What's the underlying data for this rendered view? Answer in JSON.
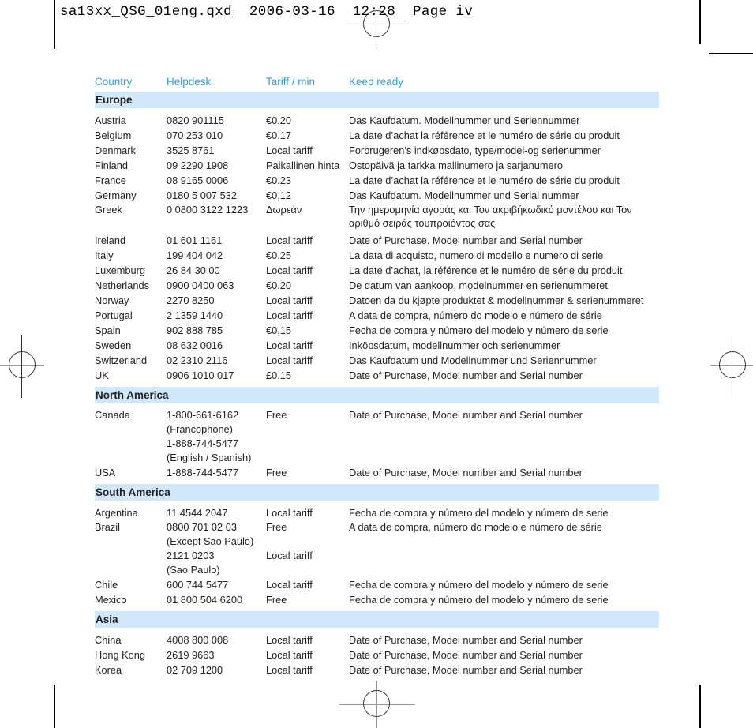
{
  "slug": "sa13xx_QSG_01eng.qxd  2006-03-16  12:28  Page iv",
  "colors": {
    "header_text": "#2e9ee0",
    "section_band": "#d0e8fa",
    "body_text": "#231f20"
  },
  "table": {
    "columns": [
      "Country",
      "Helpdesk",
      "Tariff / min",
      "Keep ready"
    ],
    "sections": [
      {
        "name": "Europe",
        "rows": [
          {
            "country": "Austria",
            "helpdesk": "0820 901115",
            "tariff": "€0.20",
            "keep": "Das Kaufdatum. Modellnummer und Seriennummer"
          },
          {
            "country": "Belgium",
            "helpdesk": "070 253 010",
            "tariff": "€0.17",
            "keep": "La date d’achat la référence et le numéro de série du produit"
          },
          {
            "country": "Denmark",
            "helpdesk": "3525 8761",
            "tariff": "Local tariff",
            "keep": "Forbrugeren's indkøbsdato, type/model-og serienummer"
          },
          {
            "country": "Finland",
            "helpdesk": "09 2290 1908",
            "tariff": "Paikallinen hinta",
            "keep": "Ostopäivä ja tarkka mallinumero ja sarjanumero"
          },
          {
            "country": "France",
            "helpdesk": "08 9165 0006",
            "tariff": "€0.23",
            "keep": "La date d’achat la référence et le numéro de série du produit"
          },
          {
            "country": "Germany",
            "helpdesk": "0180 5 007 532",
            "tariff": "€0,12",
            "keep": "Das Kaufdatum. Modellnummer und Serial nummer"
          },
          {
            "country": "Greek",
            "helpdesk": "0 0800 3122 1223",
            "tariff": "Δωρεάν",
            "keep": "Την ημερομηνία αγοράς και Τον ακριβήκωδικό μοντέλου και Τον\nαριθμό σειράς τουπροϊόντος σας"
          },
          {
            "country": "Ireland",
            "helpdesk": "01 601 1161",
            "tariff": "Local tariff",
            "keep": "Date of Purchase. Model number and Serial number"
          },
          {
            "country": "Italy",
            "helpdesk": "199 404 042",
            "tariff": "€0.25",
            "keep": "La data di acquisto, numero di modello e numero di serie"
          },
          {
            "country": "Luxemburg",
            "helpdesk": "26 84 30 00",
            "tariff": "Local tariff",
            "keep": "La date d’achat, la référence et le numéro de série du produit"
          },
          {
            "country": "Netherlands",
            "helpdesk": "0900 0400 063",
            "tariff": "€0.20",
            "keep": "De datum van aankoop, modelnummer en serienummeret"
          },
          {
            "country": "Norway",
            "helpdesk": "2270 8250",
            "tariff": "Local tariff",
            "keep": "Datoen da du kjøpte produktet & modellnummer & serienummeret"
          },
          {
            "country": "Portugal",
            "helpdesk": "2 1359 1440",
            "tariff": "Local tariff",
            "keep": "A data de compra, número do modelo e número de série"
          },
          {
            "country": "Spain",
            "helpdesk": "902 888 785",
            "tariff": "€0,15",
            "keep": "Fecha de compra y número del modelo y número de serie"
          },
          {
            "country": "Sweden",
            "helpdesk": "08 632 0016",
            "tariff": "Local tariff",
            "keep": "Inköpsdatum, modellnummer och serienummer"
          },
          {
            "country": "Switzerland",
            "helpdesk": "02 2310 2116",
            "tariff": "Local tariff",
            "keep": "Das Kaufdatum und Modellnummer und Seriennummer"
          },
          {
            "country": "UK",
            "helpdesk": "0906 1010 017",
            "tariff": "£0.15",
            "keep": "Date of Purchase, Model number and Serial number"
          }
        ]
      },
      {
        "name": "North America",
        "rows": [
          {
            "country": "Canada",
            "helpdesk": "1-800-661-6162\n(Francophone)\n1-888-744-5477\n(English / Spanish)",
            "tariff": "Free",
            "keep": "Date of Purchase, Model number and Serial number"
          },
          {
            "country": "USA",
            "helpdesk": "1-888-744-5477",
            "tariff": "Free",
            "keep": "Date of Purchase, Model number and Serial number"
          }
        ]
      },
      {
        "name": "South America",
        "rows": [
          {
            "country": "Argentina",
            "helpdesk": "11 4544 2047",
            "tariff": "Local tariff",
            "keep": "Fecha de compra y número del modelo y número de serie"
          },
          {
            "country": "Brazil",
            "helpdesk": "0800 701 02 03\n(Except Sao Paulo)\n2121 0203\n(Sao Paulo)",
            "tariff": "Free\n\nLocal tariff",
            "keep": "A data de compra, número do modelo e número de série"
          },
          {
            "country": "Chile",
            "helpdesk": "600 744 5477",
            "tariff": "Local tariff",
            "keep": "Fecha de compra y número del modelo y número de serie"
          },
          {
            "country": "Mexico",
            "helpdesk": "01 800 504 6200",
            "tariff": "Free",
            "keep": "Fecha de compra y número del modelo y número de serie"
          }
        ]
      },
      {
        "name": "Asia",
        "rows": [
          {
            "country": "China",
            "helpdesk": "4008 800 008",
            "tariff": "Local tariff",
            "keep": "Date of Purchase, Model number and Serial number"
          },
          {
            "country": "Hong Kong",
            "helpdesk": "2619 9663",
            "tariff": "Local tariff",
            "keep": "Date of Purchase, Model number and Serial number"
          },
          {
            "country": "Korea",
            "helpdesk": "02 709 1200",
            "tariff": "Local tariff",
            "keep": "Date of Purchase, Model number and Serial number"
          }
        ]
      }
    ]
  }
}
